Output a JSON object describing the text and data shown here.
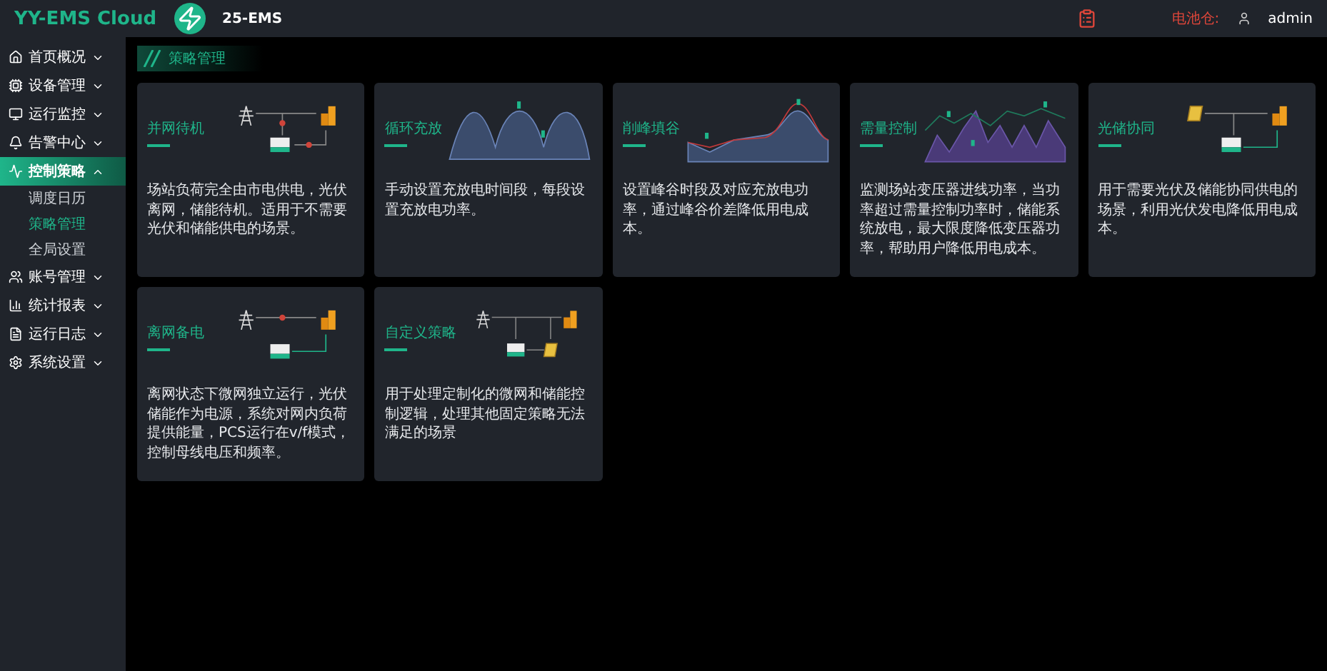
{
  "header": {
    "logo": "YY-EMS Cloud",
    "project": "25-EMS",
    "station_label": "电池仓:",
    "user": "admin"
  },
  "sidebar": {
    "items": [
      {
        "label": "首页概况",
        "selected": false,
        "expanded": false
      },
      {
        "label": "设备管理",
        "selected": false,
        "expanded": false
      },
      {
        "label": "运行监控",
        "selected": false,
        "expanded": false
      },
      {
        "label": "告警中心",
        "selected": false,
        "expanded": false
      },
      {
        "label": "控制策略",
        "selected": true,
        "expanded": true,
        "children": [
          {
            "label": "调度日历",
            "selected": false
          },
          {
            "label": "策略管理",
            "selected": true
          },
          {
            "label": "全局设置",
            "selected": false
          }
        ]
      },
      {
        "label": "账号管理",
        "selected": false,
        "expanded": false
      },
      {
        "label": "统计报表",
        "selected": false,
        "expanded": false
      },
      {
        "label": "运行日志",
        "selected": false,
        "expanded": false
      },
      {
        "label": "系统设置",
        "selected": false,
        "expanded": false
      }
    ]
  },
  "page_tag": "策略管理",
  "cards": [
    {
      "kind": "grid-standby",
      "title": "并网待机",
      "description": "场站负荷完全由市电供电，光伏离网，储能待机。适用于不需要光伏和储能供电的场景。"
    },
    {
      "kind": "cycle",
      "title": "循环充放",
      "description": "手动设置充放电时间段，每段设置充放电功率。"
    },
    {
      "kind": "peak-valley",
      "title": "削峰填谷",
      "description": "设置峰谷时段及对应充放电功率，通过峰谷价差降低用电成本。"
    },
    {
      "kind": "demand",
      "title": "需量控制",
      "description": "监测场站变压器进线功率，当功率超过需量控制功率时，储能系统放电，最大限度降低变压器功率，帮助用户降低用电成本。"
    },
    {
      "kind": "pv-storage",
      "title": "光储协同",
      "description": "用于需要光伏及储能协同供电的场景，利用光伏发电降低用电成本。"
    },
    {
      "kind": "offgrid",
      "title": "离网备电",
      "description": "离网状态下微网独立运行，光伏储能作为电源，系统对网内负荷提供能量，PCS运行在v/f模式，控制母线电压和频率。"
    },
    {
      "kind": "custom",
      "title": "自定义策略",
      "description": "用于处理定制化的微网和储能控制逻辑，处理其他固定策略无法满足的场景"
    }
  ]
}
